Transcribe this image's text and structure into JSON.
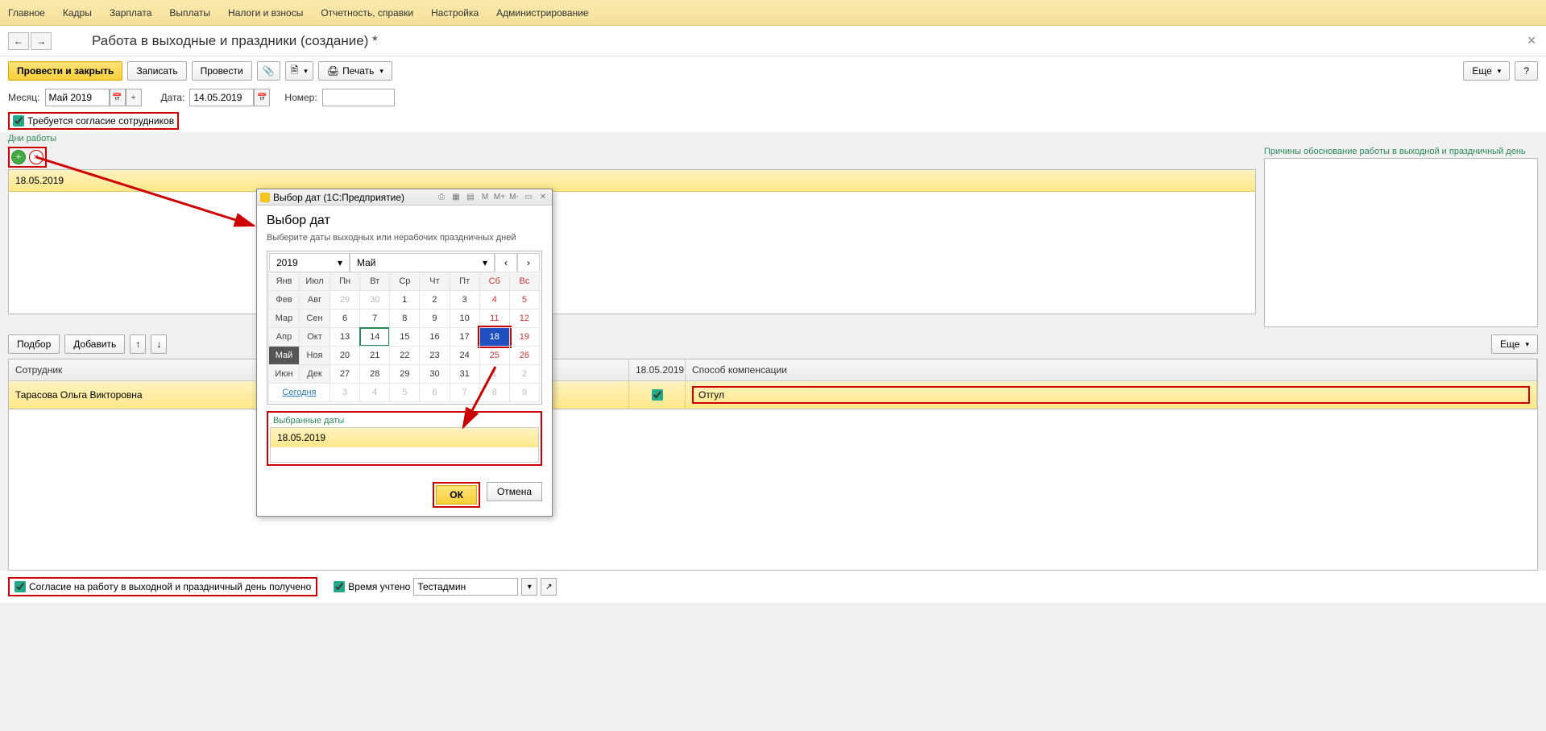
{
  "menu": [
    "Главное",
    "Кадры",
    "Зарплата",
    "Выплаты",
    "Налоги и взносы",
    "Отчетность, справки",
    "Настройка",
    "Администрирование"
  ],
  "title": "Работа в выходные и праздники (создание) *",
  "toolbar": {
    "post_close": "Провести и закрыть",
    "save": "Записать",
    "post": "Провести",
    "print": "Печать",
    "more": "Еще",
    "help": "?"
  },
  "form": {
    "month_label": "Месяц:",
    "month_value": "Май 2019",
    "date_label": "Дата:",
    "date_value": "14.05.2019",
    "number_label": "Номер:",
    "number_value": ""
  },
  "consent_required_label": "Требуется согласие сотрудников",
  "work_days_label": "Дни работы",
  "reasons_label": "Причины обоснование работы в выходной и праздничный день",
  "work_days": [
    "18.05.2019"
  ],
  "emp_toolbar": {
    "pick": "Подбор",
    "add": "Добавить",
    "more": "Еще"
  },
  "emp_table": {
    "col_employee": "Сотрудник",
    "col_date": "18.05.2019",
    "col_comp": "Способ компенсации",
    "rows": [
      {
        "employee": "Тарасова Ольга Викторовна",
        "checked": true,
        "comp": "Отгул"
      }
    ]
  },
  "bottom": {
    "consent_received": "Согласие на работу в выходной и праздничный день получено",
    "time_accounted": "Время учтено",
    "accounted_by": "Тестадмин"
  },
  "dialog": {
    "wintitle": "Выбор дат  (1С:Предприятие)",
    "title": "Выбор дат",
    "hint": "Выберите даты выходных или нерабочих праздничных дней",
    "year": "2019",
    "month": "Май",
    "month_short": [
      "Янв",
      "Фев",
      "Мар",
      "Апр",
      "Май",
      "Июн",
      "Июл",
      "Авг",
      "Сен",
      "Окт",
      "Ноя",
      "Дек"
    ],
    "dow": [
      "Пн",
      "Вт",
      "Ср",
      "Чт",
      "Пт",
      "Сб",
      "Вс"
    ],
    "today_link": "Сегодня",
    "selected_label": "Выбранные даты",
    "selected": [
      "18.05.2019"
    ],
    "ok": "ОК",
    "cancel": "Отмена"
  }
}
